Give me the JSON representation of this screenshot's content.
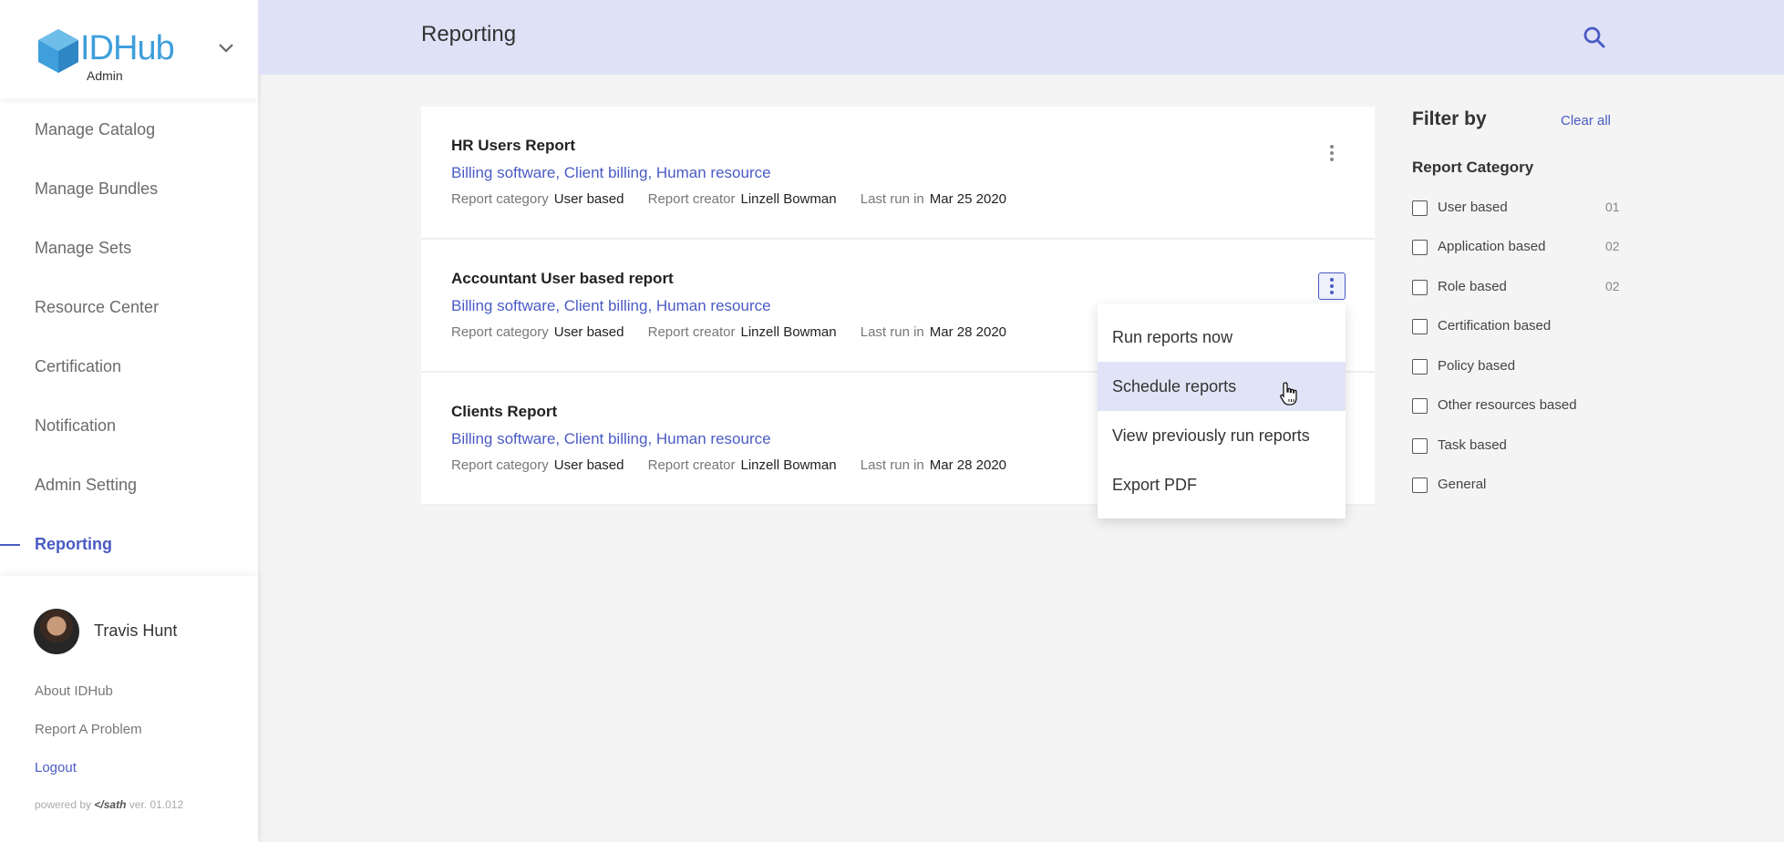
{
  "brand": {
    "name": "IDHub",
    "subtitle": "Admin"
  },
  "sidebar": {
    "items": [
      {
        "label": "Manage Catalog"
      },
      {
        "label": "Manage Bundles"
      },
      {
        "label": "Manage Sets"
      },
      {
        "label": "Resource Center"
      },
      {
        "label": "Certification"
      },
      {
        "label": "Notification"
      },
      {
        "label": "Admin Setting"
      },
      {
        "label": "Reporting",
        "active": true
      }
    ]
  },
  "profile": {
    "name": "Travis Hunt",
    "links": {
      "about": "About IDHub",
      "report_problem": "Report A Problem",
      "logout": "Logout"
    },
    "powered_prefix": "powered by",
    "powered_brand": "sath",
    "version": "ver. 01.012"
  },
  "header": {
    "title": "Reporting"
  },
  "meta_labels": {
    "category": "Report category",
    "creator": "Report creator",
    "last_run": "Last run in"
  },
  "reports": [
    {
      "title": "HR Users Report",
      "tags": [
        "Billing software",
        "Client billing",
        "Human resource"
      ],
      "category": "User based",
      "creator": "Linzell Bowman",
      "last_run": "Mar 25 2020"
    },
    {
      "title": "Accountant User based report",
      "tags": [
        "Billing software",
        "Client billing",
        "Human resource"
      ],
      "category": "User based",
      "creator": "Linzell Bowman",
      "last_run": "Mar 28 2020"
    },
    {
      "title": "Clients Report",
      "tags": [
        "Billing software",
        "Client billing",
        "Human resource"
      ],
      "category": "User based",
      "creator": "Linzell Bowman",
      "last_run": "Mar 28 2020"
    }
  ],
  "menu": {
    "items": [
      {
        "label": "Run reports now"
      },
      {
        "label": "Schedule reports",
        "hover": true
      },
      {
        "label": "View previously run reports"
      },
      {
        "label": "Export PDF"
      }
    ]
  },
  "filter": {
    "title": "Filter by",
    "clear_all": "Clear all",
    "category_title": "Report Category",
    "options": [
      {
        "label": "User based",
        "count": "01"
      },
      {
        "label": "Application based",
        "count": "02"
      },
      {
        "label": "Role based",
        "count": "02"
      },
      {
        "label": "Certification based",
        "count": ""
      },
      {
        "label": "Policy based",
        "count": ""
      },
      {
        "label": "Other resources based",
        "count": ""
      },
      {
        "label": "Task based",
        "count": ""
      },
      {
        "label": "General",
        "count": ""
      }
    ]
  },
  "colors": {
    "accent": "#4a5bc4",
    "header_bg": "#dfe2f6",
    "logo": "#3f9fdc",
    "menu_hover": "#e1e4f6"
  }
}
